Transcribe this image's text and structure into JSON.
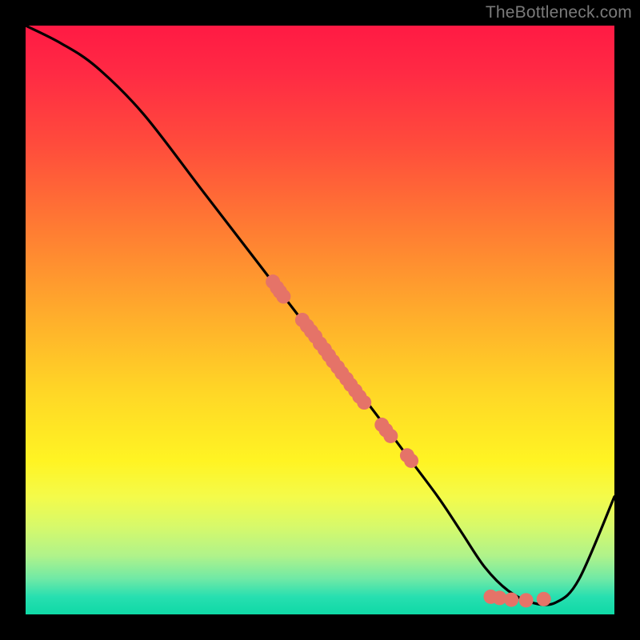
{
  "watermark": "TheBottleneck.com",
  "chart_data": {
    "type": "line",
    "title": "",
    "xlabel": "",
    "ylabel": "",
    "xlim": [
      0,
      100
    ],
    "ylim": [
      0,
      100
    ],
    "grid": false,
    "legend": false,
    "series": [
      {
        "name": "curve",
        "x": [
          0,
          6,
          12,
          20,
          30,
          40,
          50,
          58,
          64,
          70,
          74,
          78,
          82,
          86,
          90,
          94,
          100
        ],
        "y": [
          100,
          97,
          93,
          85,
          72,
          59,
          46,
          36,
          28,
          20,
          14,
          8,
          4,
          2,
          2,
          6,
          20
        ]
      }
    ],
    "scatter": {
      "name": "dots",
      "color": "#e57368",
      "points": [
        {
          "x": 42.0,
          "y": 56.5
        },
        {
          "x": 42.7,
          "y": 55.5
        },
        {
          "x": 43.2,
          "y": 54.8
        },
        {
          "x": 43.8,
          "y": 54.0
        },
        {
          "x": 47.0,
          "y": 50.0
        },
        {
          "x": 47.8,
          "y": 49.0
        },
        {
          "x": 48.5,
          "y": 48.1
        },
        {
          "x": 49.2,
          "y": 47.2
        },
        {
          "x": 50.0,
          "y": 46.0
        },
        {
          "x": 50.8,
          "y": 45.0
        },
        {
          "x": 51.5,
          "y": 44.0
        },
        {
          "x": 52.2,
          "y": 43.0
        },
        {
          "x": 53.0,
          "y": 42.0
        },
        {
          "x": 53.7,
          "y": 41.0
        },
        {
          "x": 54.5,
          "y": 40.0
        },
        {
          "x": 55.2,
          "y": 39.0
        },
        {
          "x": 56.0,
          "y": 38.0
        },
        {
          "x": 56.7,
          "y": 37.0
        },
        {
          "x": 57.5,
          "y": 36.0
        },
        {
          "x": 60.5,
          "y": 32.2
        },
        {
          "x": 61.2,
          "y": 31.3
        },
        {
          "x": 62.0,
          "y": 30.3
        },
        {
          "x": 64.8,
          "y": 27.0
        },
        {
          "x": 65.5,
          "y": 26.1
        },
        {
          "x": 79.0,
          "y": 3.0
        },
        {
          "x": 80.5,
          "y": 2.8
        },
        {
          "x": 82.5,
          "y": 2.5
        },
        {
          "x": 85.0,
          "y": 2.4
        },
        {
          "x": 88.0,
          "y": 2.6
        }
      ]
    }
  }
}
